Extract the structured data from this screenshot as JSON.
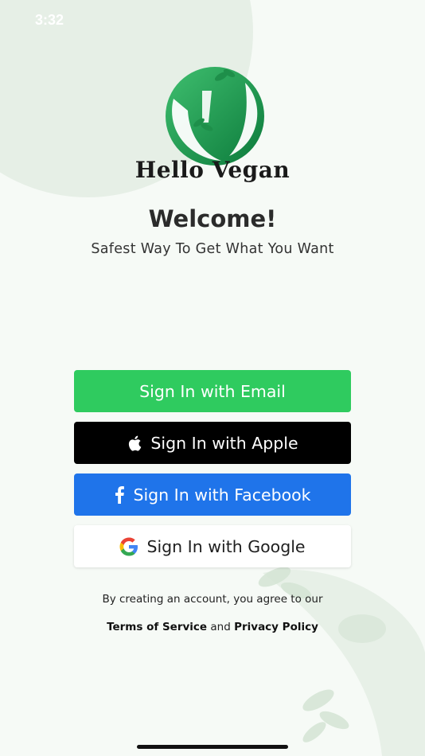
{
  "status_bar": {
    "time": "3:32"
  },
  "brand": {
    "name": "Hello Vegan"
  },
  "welcome": {
    "title": "Welcome!",
    "subtitle": "Safest Way To Get What You Want"
  },
  "buttons": {
    "email": "Sign In with Email",
    "apple": "Sign In with Apple",
    "facebook": "Sign In with Facebook",
    "google": "Sign In with Google"
  },
  "legal": {
    "text": "By creating an account, you agree to our",
    "terms": "Terms of Service",
    "and": "and",
    "privacy": "Privacy Policy"
  },
  "colors": {
    "email_button": "#2fcb5f",
    "apple_button": "#000000",
    "facebook_button": "#1f74ea",
    "google_button": "#ffffff",
    "brand_green": "#1f9d55"
  },
  "icons": [
    "apple-icon",
    "facebook-icon",
    "google-icon",
    "vegan-logo"
  ]
}
